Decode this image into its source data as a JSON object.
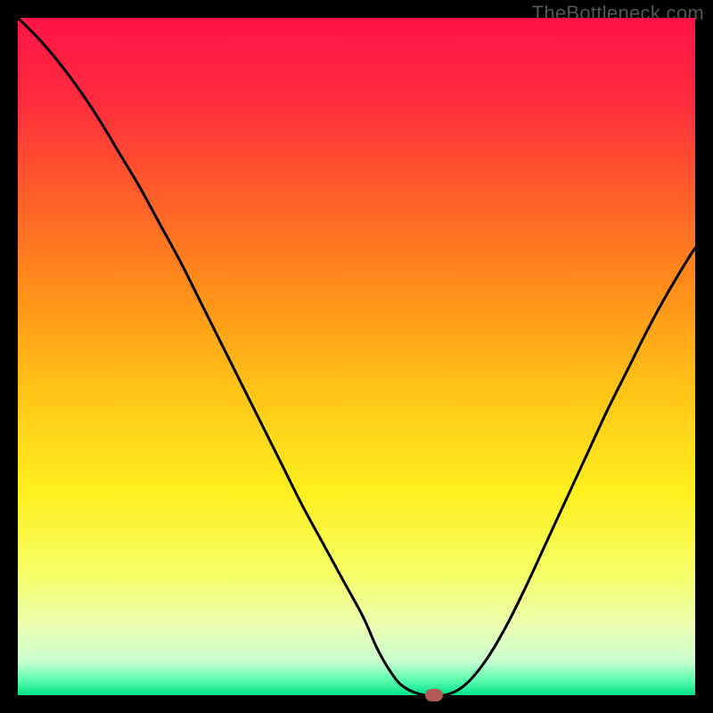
{
  "watermark": "TheBottleneck.com",
  "chart_data": {
    "type": "line",
    "title": "",
    "xlabel": "",
    "ylabel": "",
    "xlim": [
      0,
      100
    ],
    "ylim": [
      0,
      100
    ],
    "grid": false,
    "legend": false,
    "background_gradient": {
      "stops": [
        {
          "pos": 0.0,
          "color": "#ff1347"
        },
        {
          "pos": 0.12,
          "color": "#ff2b3e"
        },
        {
          "pos": 0.25,
          "color": "#ff5a2a"
        },
        {
          "pos": 0.4,
          "color": "#ff8e1a"
        },
        {
          "pos": 0.55,
          "color": "#ffc416"
        },
        {
          "pos": 0.7,
          "color": "#fff01e"
        },
        {
          "pos": 0.82,
          "color": "#f6ff66"
        },
        {
          "pos": 0.9,
          "color": "#eaffb3"
        },
        {
          "pos": 0.95,
          "color": "#c9ffd0"
        },
        {
          "pos": 0.975,
          "color": "#66ffb3"
        },
        {
          "pos": 1.0,
          "color": "#00e38a"
        }
      ]
    },
    "series": [
      {
        "name": "bottleneck-curve",
        "stroke": "#000000",
        "stroke_width": 3,
        "x": [
          0,
          3,
          6,
          9,
          12,
          15,
          18,
          21,
          24,
          27,
          30,
          33,
          36,
          39,
          42,
          45,
          48,
          51,
          53,
          55,
          57,
          60,
          63,
          66,
          69,
          72,
          75,
          78,
          81,
          84,
          87,
          90,
          93,
          96,
          99,
          100
        ],
        "y": [
          100,
          97,
          93.5,
          89.5,
          85,
          80,
          75,
          69.5,
          64,
          58,
          52,
          46,
          40,
          34,
          28,
          22.5,
          17,
          11.5,
          7,
          3.5,
          1.2,
          0,
          0,
          1.5,
          5,
          10,
          16,
          22.5,
          29,
          35.5,
          42,
          48,
          54,
          59.5,
          64.5,
          66
        ]
      }
    ],
    "markers": [
      {
        "name": "optimal-point",
        "x": 61.5,
        "y": 0,
        "color": "#b25a56"
      }
    ]
  }
}
